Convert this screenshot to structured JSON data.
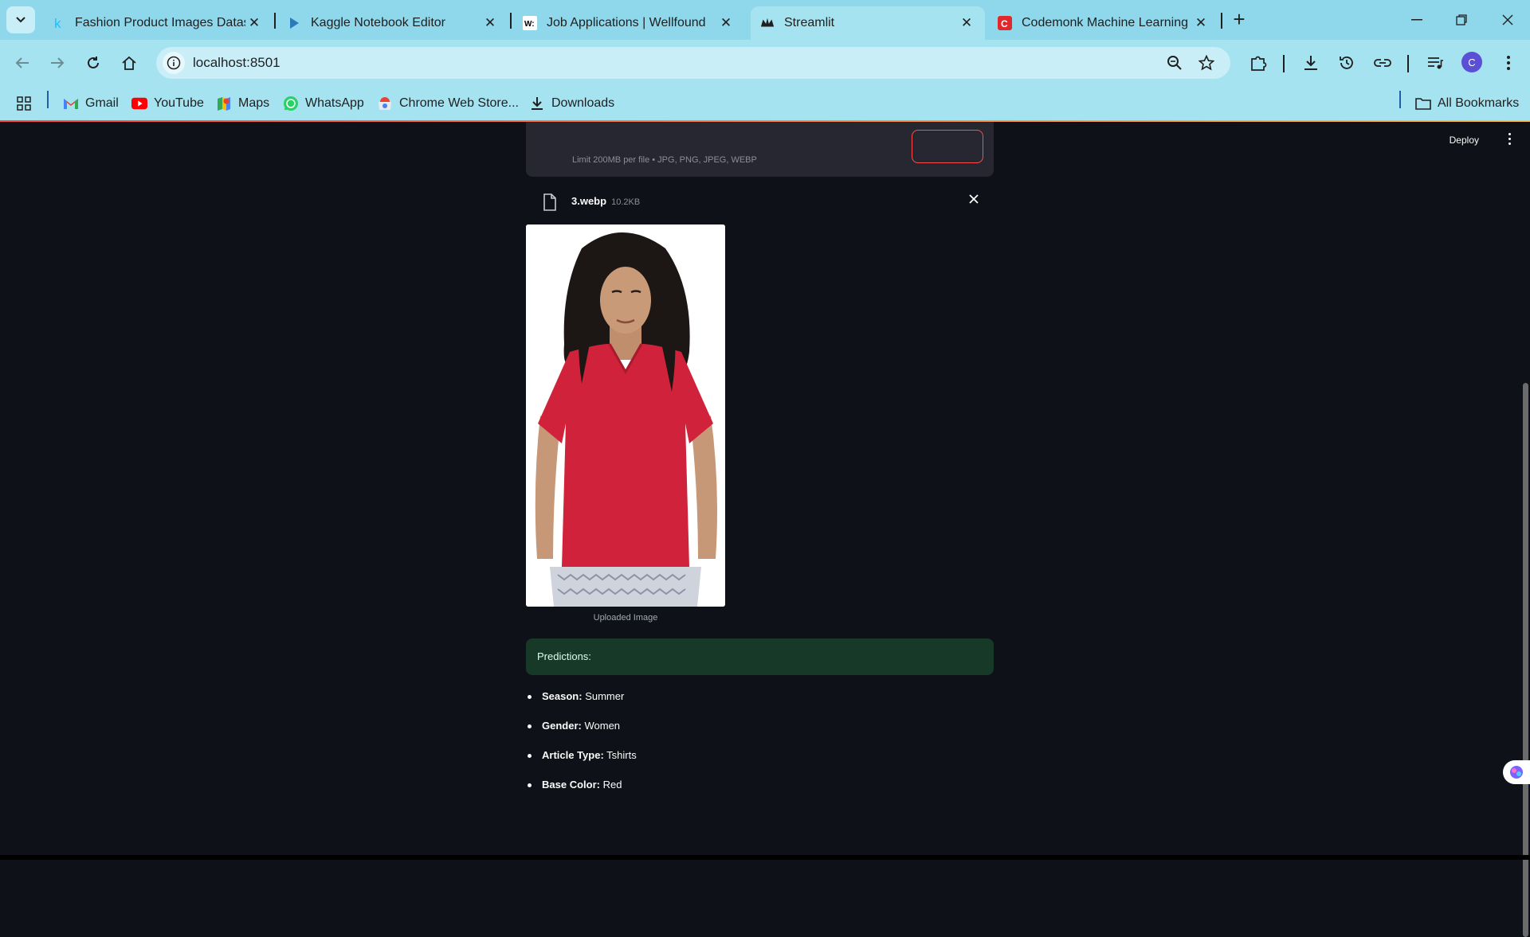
{
  "browser": {
    "tabs": [
      {
        "title": "Fashion Product Images Datase",
        "icon": "kaggle-icon"
      },
      {
        "title": "Kaggle Notebook Editor",
        "icon": "kaggle-play-icon"
      },
      {
        "title": "Job Applications | Wellfound",
        "icon": "wellfound-icon"
      },
      {
        "title": "Streamlit",
        "icon": "streamlit-icon",
        "active": true
      },
      {
        "title": "Codemonk Machine Learning Ir",
        "icon": "codemonk-icon"
      }
    ],
    "url": "localhost:8501",
    "bookmarks": [
      {
        "label": "Gmail",
        "icon": "gmail-icon"
      },
      {
        "label": "YouTube",
        "icon": "youtube-icon"
      },
      {
        "label": "Maps",
        "icon": "maps-icon"
      },
      {
        "label": "WhatsApp",
        "icon": "whatsapp-icon"
      },
      {
        "label": "Chrome Web Store...",
        "icon": "webstore-icon"
      },
      {
        "label": "Downloads",
        "icon": "download-icon"
      }
    ],
    "all_bookmarks": "All Bookmarks",
    "profile_initial": "C"
  },
  "app": {
    "deploy_label": "Deploy",
    "uploader_limit": "Limit 200MB per file • JPG, PNG, JPEG, WEBP",
    "file": {
      "name": "3.webp",
      "size": "10.2KB"
    },
    "image_caption": "Uploaded Image",
    "predictions_title": "Predictions:",
    "predictions": [
      {
        "label": "Season:",
        "value": "Summer"
      },
      {
        "label": "Gender:",
        "value": "Women"
      },
      {
        "label": "Article Type:",
        "value": "Tshirts"
      },
      {
        "label": "Base Color:",
        "value": "Red"
      }
    ]
  },
  "colors": {
    "tab_bar": "#8fd8eb",
    "toolbar": "#a6e3f0",
    "app_bg": "#0e1117",
    "success_bg": "#173928",
    "accent": "#ff4b4b",
    "shirt": "#d0223a"
  }
}
